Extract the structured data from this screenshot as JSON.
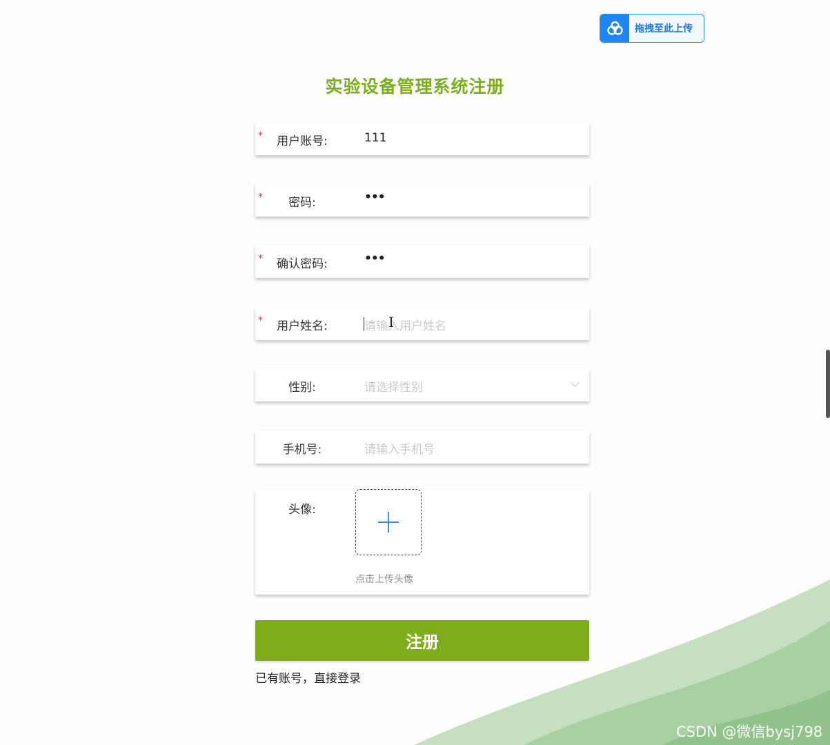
{
  "upload_badge": {
    "label": "拖拽至此上传",
    "icon": "cloud-upload-icon",
    "color": "#1e86f5"
  },
  "title": "实验设备管理系统注册",
  "fields": {
    "account": {
      "label": "用户账号:",
      "value": "111",
      "required": "*"
    },
    "password": {
      "label": "密码:",
      "value": "•••",
      "required": "*"
    },
    "confirm_password": {
      "label": "确认密码:",
      "value": "•••",
      "required": "*"
    },
    "name": {
      "label": "用户姓名:",
      "placeholder": "请输入用户姓名",
      "required": "*"
    },
    "gender": {
      "label": "性别:",
      "placeholder": "请选择性别"
    },
    "phone": {
      "label": "手机号:",
      "placeholder": "请输入手机号"
    },
    "avatar": {
      "label": "头像:",
      "tip": "点击上传头像"
    }
  },
  "register_button": "注册",
  "login_link": "已有账号，直接登录",
  "watermark": "CSDN @微信bysj798",
  "colors": {
    "accent_green": "#7fad1a",
    "title_green": "#7caf1f",
    "required_red": "#e03e3e"
  }
}
